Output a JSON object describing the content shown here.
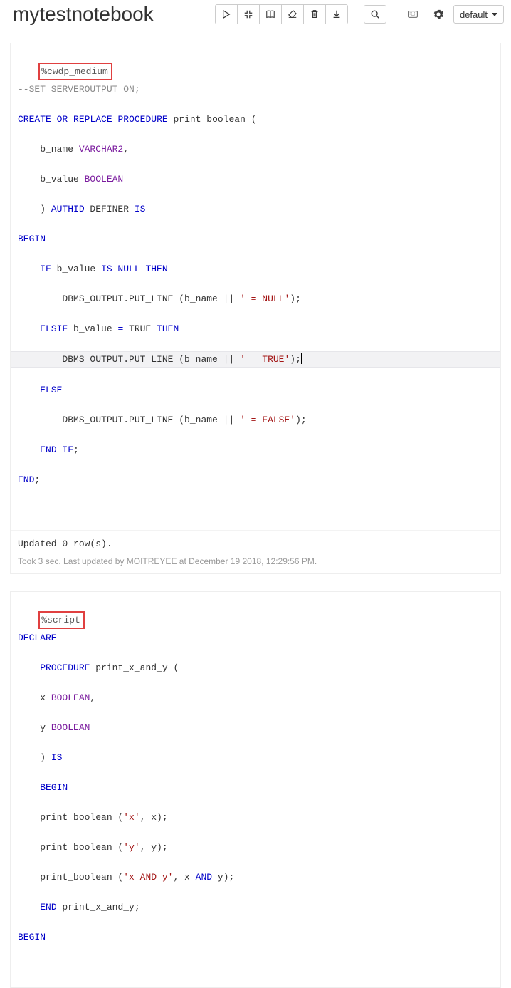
{
  "header": {
    "title": "mytestnotebook",
    "mode": "default"
  },
  "cells": [
    {
      "interpreter": "%cwdp_medium",
      "output": "Updated 0 row(s).",
      "meta": "Took 3 sec. Last updated by MOITREYEE at December 19 2018, 12:29:56 PM.",
      "code": {
        "l1": "--SET SERVEROUTPUT ON;",
        "l2a": "CREATE",
        "l2b": "OR",
        "l2c": "REPLACE",
        "l2d": "PROCEDURE",
        "l2e": " print_boolean (",
        "l3a": "    b_name ",
        "l3b": "VARCHAR2",
        "l3c": ",",
        "l4a": "    b_value ",
        "l4b": "BOOLEAN",
        "l5a": "    ) ",
        "l5b": "AUTHID",
        "l5c": " DEFINER ",
        "l5d": "IS",
        "l6": "BEGIN",
        "l7a": "    IF",
        "l7b": " b_value ",
        "l7c": "IS NULL THEN",
        "l8a": "        DBMS_OUTPUT.PUT_LINE (b_name || ",
        "l8b": "' = NULL'",
        "l8c": ");",
        "l9a": "    ELSIF",
        "l9b": " b_value ",
        "l9c": "=",
        "l9d": " TRUE ",
        "l9e": "THEN",
        "l10a": "        DBMS_OUTPUT.PUT_LINE (b_name || ",
        "l10b": "' = TRUE'",
        "l10c": ");",
        "l11": "    ELSE",
        "l12a": "        DBMS_OUTPUT.PUT_LINE (b_name || ",
        "l12b": "' = FALSE'",
        "l12c": ");",
        "l13a": "    ",
        "l13b": "END IF",
        "l13c": ";",
        "l14a": "END",
        "l14b": ";"
      }
    },
    {
      "interpreter": "%script",
      "code": {
        "l1": "DECLARE",
        "l2a": "    ",
        "l2b": "PROCEDURE",
        "l2c": " print_x_and_y (",
        "l3a": "    x ",
        "l3b": "BOOLEAN",
        "l3c": ",",
        "l4a": "    y ",
        "l4b": "BOOLEAN",
        "l5a": "    ) ",
        "l5b": "IS",
        "l6a": "    ",
        "l6b": "BEGIN",
        "l7a": "    print_boolean (",
        "l7b": "'x'",
        "l7c": ", x);",
        "l8a": "    print_boolean (",
        "l8b": "'y'",
        "l8c": ", y);",
        "l9a": "    print_boolean (",
        "l9b": "'x AND y'",
        "l9c": ", x ",
        "l9d": "AND",
        "l9e": " y);",
        "l10a": "    ",
        "l10b": "END",
        "l10c": " print_x_and_y;",
        "l11": "BEGIN"
      }
    }
  ]
}
